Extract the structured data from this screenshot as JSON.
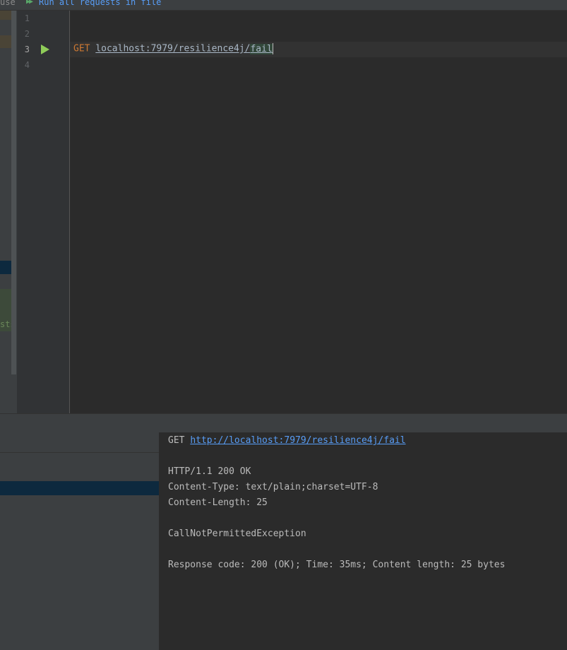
{
  "toolbar": {
    "cut_label": "use",
    "run_all_label": "Run all requests in file",
    "run_all_icon": "run-all-double-arrow-icon"
  },
  "left_strip": {
    "cut_text": "sts"
  },
  "editor": {
    "line_numbers": [
      "1",
      "2",
      "3",
      "4"
    ],
    "method": "GET",
    "url_prefix": "localhost:7979/resilience4j/",
    "url_last": "fail"
  },
  "output": {
    "request_method": "GET",
    "request_url": "http://localhost:7979/resilience4j/fail",
    "status_line": "HTTP/1.1 200 OK",
    "content_type": "Content-Type: text/plain;charset=UTF-8",
    "content_length": "Content-Length: 25",
    "body": "CallNotPermittedException",
    "summary": "Response code: 200 (OK); Time: 35ms; Content length: 25 bytes"
  },
  "colors": {
    "background": "#2b2b2b",
    "keyword": "#cc7832",
    "link": "#589df6",
    "run_icon": "#8fcc59",
    "selection": "#0d293e"
  }
}
